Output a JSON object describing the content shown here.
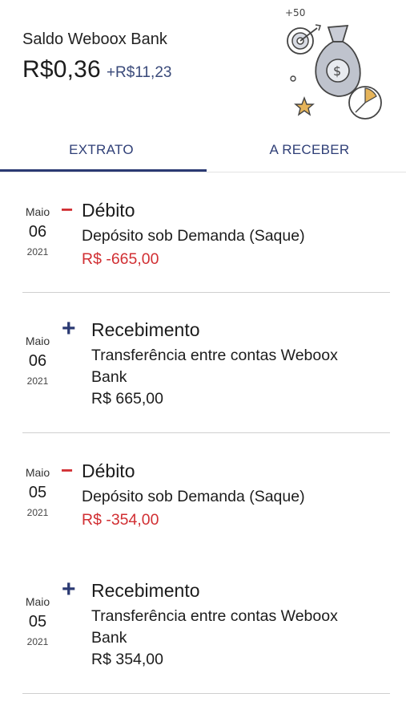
{
  "header": {
    "balance_label": "Saldo Weboox Bank",
    "balance_value": "R$0,36",
    "balance_delta": "+R$11,23",
    "illustration_text": "+50"
  },
  "tabs": [
    {
      "label": "EXTRATO",
      "active": true
    },
    {
      "label": "A RECEBER",
      "active": false
    }
  ],
  "transactions": [
    {
      "month": "Maio",
      "day": "06",
      "year": "2021",
      "sign": "−",
      "type": "Débito",
      "description": "Depósito sob Demanda (Saque)",
      "amount": "R$ -665,00"
    },
    {
      "month": "Maio",
      "day": "06",
      "year": "2021",
      "sign": "+",
      "type": "Recebimento",
      "description_line1": "Transferência entre contas Weboox",
      "description_line2": "Bank",
      "amount": "R$ 665,00"
    },
    {
      "month": "Maio",
      "day": "05",
      "year": "2021",
      "sign": "−",
      "type": "Débito",
      "description": "Depósito sob Demanda (Saque)",
      "amount": "R$ -354,00"
    },
    {
      "month": "Maio",
      "day": "05",
      "year": "2021",
      "sign": "+",
      "type": "Recebimento",
      "description_line1": "Transferência entre contas Weboox",
      "description_line2": "Bank",
      "amount": "R$ 354,00"
    }
  ],
  "colors": {
    "accent": "#2b3a73",
    "negative": "#d12f33"
  }
}
